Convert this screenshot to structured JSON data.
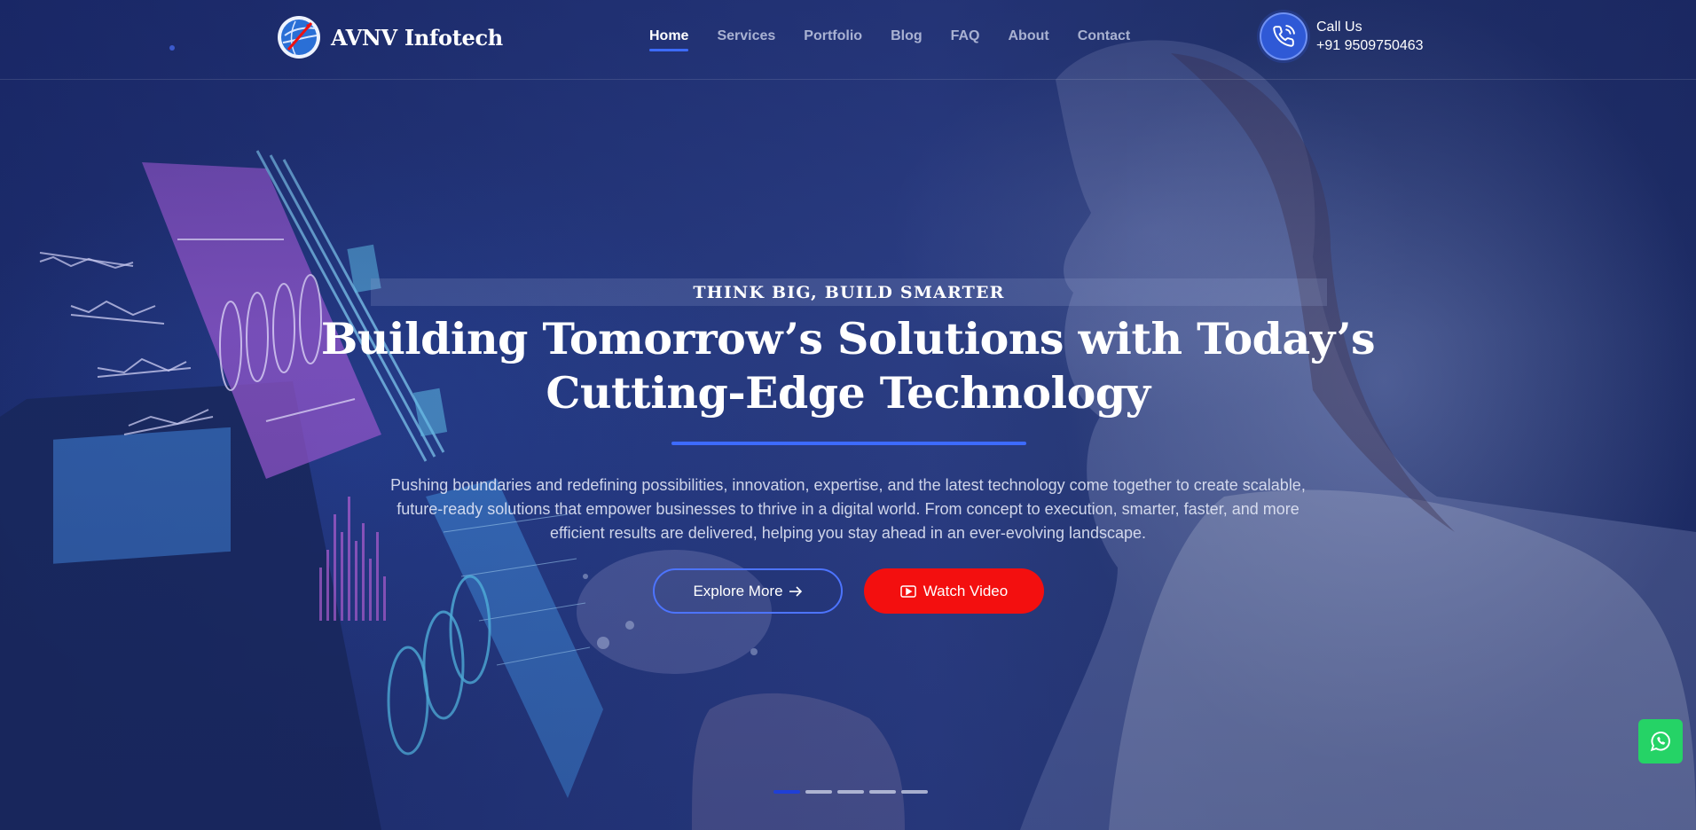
{
  "brand": {
    "name": "AVNV Infotech",
    "logo_icon": "globe-logo-icon"
  },
  "nav": {
    "items": [
      {
        "label": "Home",
        "active": true
      },
      {
        "label": "Services",
        "active": false
      },
      {
        "label": "Portfolio",
        "active": false
      },
      {
        "label": "Blog",
        "active": false
      },
      {
        "label": "FAQ",
        "active": false
      },
      {
        "label": "About",
        "active": false
      },
      {
        "label": "Contact",
        "active": false
      }
    ]
  },
  "contact": {
    "label": "Call Us",
    "phone": "+91 9509750463",
    "icon": "phone-icon"
  },
  "hero": {
    "tagline": "THINK BIG, BUILD SMARTER",
    "headline_line1": "Building Tomorrow’s Solutions with Today’s",
    "headline_line2": "Cutting-Edge Technology",
    "description": "Pushing boundaries and redefining possibilities, innovation, expertise, and the latest technology come together to create scalable, future-ready solutions that empower businesses to thrive in a digital world. From concept to execution, smarter, faster, and more efficient results are delivered, helping you stay ahead in an ever-evolving landscape.",
    "explore_label": "Explore More",
    "watch_label": "Watch Video"
  },
  "slider": {
    "total": 5,
    "active_index": 0
  },
  "colors": {
    "accent": "#3d6bff",
    "watch_button": "#f30f0f",
    "whatsapp": "#25d366",
    "overlay": "#1b2c6e"
  }
}
